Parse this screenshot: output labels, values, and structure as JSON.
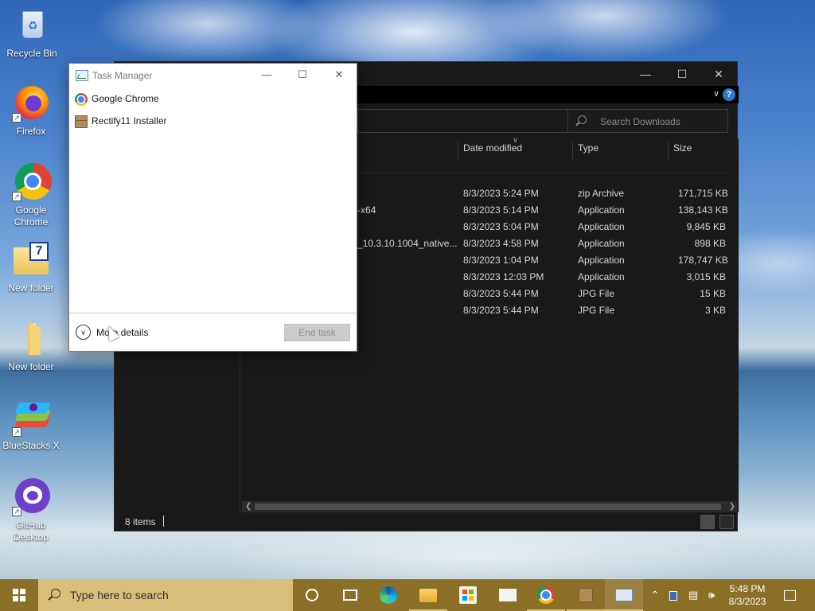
{
  "desktop": {
    "icons": [
      {
        "label": "Recycle Bin",
        "icon": "recycle-bin-icon"
      },
      {
        "label": "Firefox",
        "icon": "firefox-icon"
      },
      {
        "label": "Google Chrome",
        "icon": "chrome-icon"
      },
      {
        "label": "New folder",
        "icon": "folder-icon"
      },
      {
        "label": "New folder",
        "icon": "folder-icon"
      },
      {
        "label": "BlueStacks X",
        "icon": "bluestacks-icon"
      },
      {
        "label": "GitHub Desktop",
        "icon": "github-icon"
      }
    ]
  },
  "explorer": {
    "search_placeholder": "Search Downloads",
    "columns": {
      "date": "Date modified",
      "type": "Type",
      "size": "Size"
    },
    "rows": [
      {
        "name": "",
        "date": "8/3/2023 5:24 PM",
        "type": "zip Archive",
        "size": "171,715 KB"
      },
      {
        "name": "-x64",
        "date": "8/3/2023 5:14 PM",
        "type": "Application",
        "size": "138,143 KB"
      },
      {
        "name": "",
        "date": "8/3/2023 5:04 PM",
        "type": "Application",
        "size": "9,845 KB"
      },
      {
        "name": "_10.3.10.1004_native...",
        "date": "8/3/2023 4:58 PM",
        "type": "Application",
        "size": "898 KB"
      },
      {
        "name": "",
        "date": "8/3/2023 1:04 PM",
        "type": "Application",
        "size": "178,747 KB"
      },
      {
        "name": "",
        "date": "8/3/2023 12:03 PM",
        "type": "Application",
        "size": "3,015 KB"
      },
      {
        "name": "",
        "date": "8/3/2023 5:44 PM",
        "type": "JPG File",
        "size": "15 KB"
      },
      {
        "name": "",
        "date": "8/3/2023 5:44 PM",
        "type": "JPG File",
        "size": "3 KB"
      }
    ],
    "status_count": "8 items"
  },
  "task_manager": {
    "title": "Task Manager",
    "apps": [
      {
        "label": "Google Chrome",
        "icon": "chrome-icon"
      },
      {
        "label": "Rectify11 Installer",
        "icon": "installer-box-icon"
      }
    ],
    "more_details": "More details",
    "end_task": "End task"
  },
  "taskbar": {
    "search_placeholder": "Type here to search",
    "time": "5:48 PM",
    "date": "8/3/2023",
    "colors": {
      "taskbar": "#8c6f27",
      "search": "#d9bf7a"
    }
  }
}
